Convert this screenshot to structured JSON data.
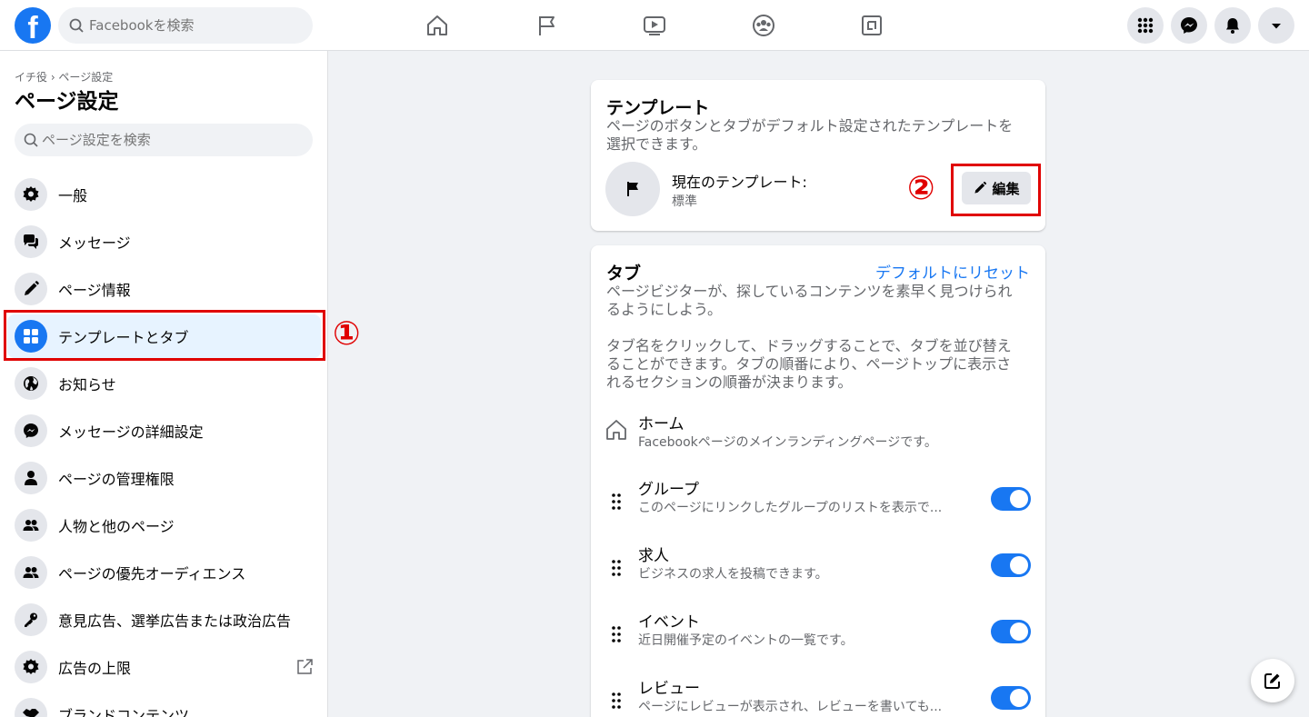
{
  "colors": {
    "brand": "#1877f2",
    "highlight": "#e00000",
    "toggle_on": "#1877f2"
  },
  "topbar": {
    "logo_letter": "f",
    "search_placeholder": "Facebookを検索",
    "nav_icons": [
      "home-icon",
      "flag-icon",
      "watch-icon",
      "groups-icon",
      "gaming-icon"
    ],
    "right_icons": [
      "menu-grid-icon",
      "messenger-icon",
      "notifications-icon",
      "account-caret-icon"
    ]
  },
  "sidebar": {
    "breadcrumb": "イチ役 › ページ設定",
    "title": "ページ設定",
    "search_placeholder": "ページ設定を検索",
    "items": [
      {
        "label": "一般",
        "icon": "gear-icon"
      },
      {
        "label": "メッセージ",
        "icon": "chat-icon"
      },
      {
        "label": "ページ情報",
        "icon": "pencil-icon"
      },
      {
        "label": "テンプレートとタブ",
        "icon": "grid-icon",
        "active": true
      },
      {
        "label": "お知らせ",
        "icon": "globe-icon"
      },
      {
        "label": "メッセージの詳細設定",
        "icon": "messenger-icon"
      },
      {
        "label": "ページの管理権限",
        "icon": "person-icon"
      },
      {
        "label": "人物と他のページ",
        "icon": "people-icon"
      },
      {
        "label": "ページの優先オーディエンス",
        "icon": "people-icon"
      },
      {
        "label": "意見広告、選挙広告または政治広告",
        "icon": "key-icon"
      },
      {
        "label": "広告の上限",
        "icon": "gear-icon",
        "external": true
      },
      {
        "label": "ブランドコンテンツ",
        "icon": "handshake-icon"
      }
    ]
  },
  "annotations": {
    "marker_1": "①",
    "marker_2": "②"
  },
  "template_card": {
    "title": "テンプレート",
    "description": "ページのボタンとタブがデフォルト設定されたテンプレートを選択できます。",
    "current_label": "現在のテンプレート:",
    "current_value": "標準",
    "edit_label": "編集"
  },
  "tabs_card": {
    "title": "タブ",
    "reset_label": "デフォルトにリセット",
    "description_1": "ページビジターが、探しているコンテンツを素早く見つけられるようにしよう。",
    "description_2": "タブ名をクリックして、ドラッグすることで、タブを並び替えることができます。タブの順番により、ページトップに表示されるセクションの順番が決まります。",
    "tabs": [
      {
        "name": "ホーム",
        "desc": "Facebookページのメインランディングページです。",
        "fixed": true
      },
      {
        "name": "グループ",
        "desc": "このページにリンクしたグループのリストを表示で...",
        "enabled": true
      },
      {
        "name": "求人",
        "desc": "ビジネスの求人を投稿できます。",
        "enabled": true
      },
      {
        "name": "イベント",
        "desc": "近日開催予定のイベントの一覧です。",
        "enabled": true
      },
      {
        "name": "レビュー",
        "desc": "ページにレビューが表示され、レビューを書いても...",
        "enabled": true
      }
    ]
  }
}
